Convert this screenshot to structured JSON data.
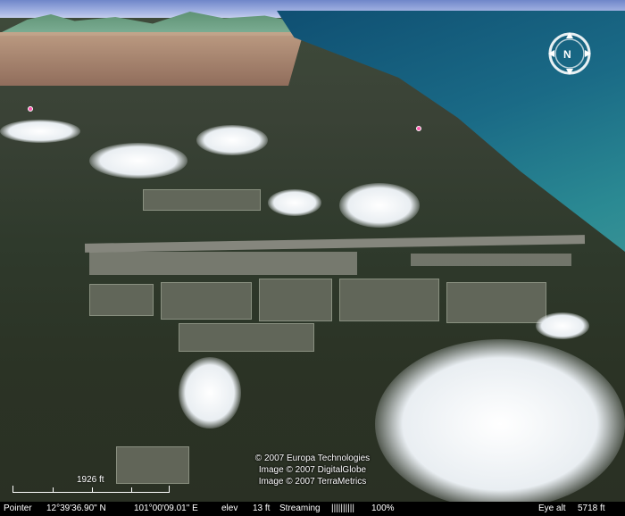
{
  "copyright": {
    "line1": "© 2007 Europa Technologies",
    "line2": "Image © 2007 DigitalGlobe",
    "line3": "Image © 2007 TerraMetrics"
  },
  "scale": {
    "label": "1926 ft"
  },
  "status": {
    "pointer_label": "Pointer",
    "latitude": "12°39'36.90\" N",
    "longitude": "101°00'09.01\" E",
    "elev_label": "elev",
    "elev_value": "13 ft",
    "streaming_label": "Streaming",
    "streaming_bar": "||||||||||",
    "streaming_percent": "100%",
    "eye_alt_label": "Eye alt",
    "eye_alt_value": "5718 ft"
  },
  "compass": {
    "north_label": "N",
    "icon": "compass-ring-icon"
  },
  "colors": {
    "sea": "#1a6a86",
    "terrain": "#2f3a2c",
    "runway": "#8f8f86",
    "placemark": "#ff5ab0",
    "overlay_text": "#ffffff",
    "statusbar_bg": "#000000"
  }
}
